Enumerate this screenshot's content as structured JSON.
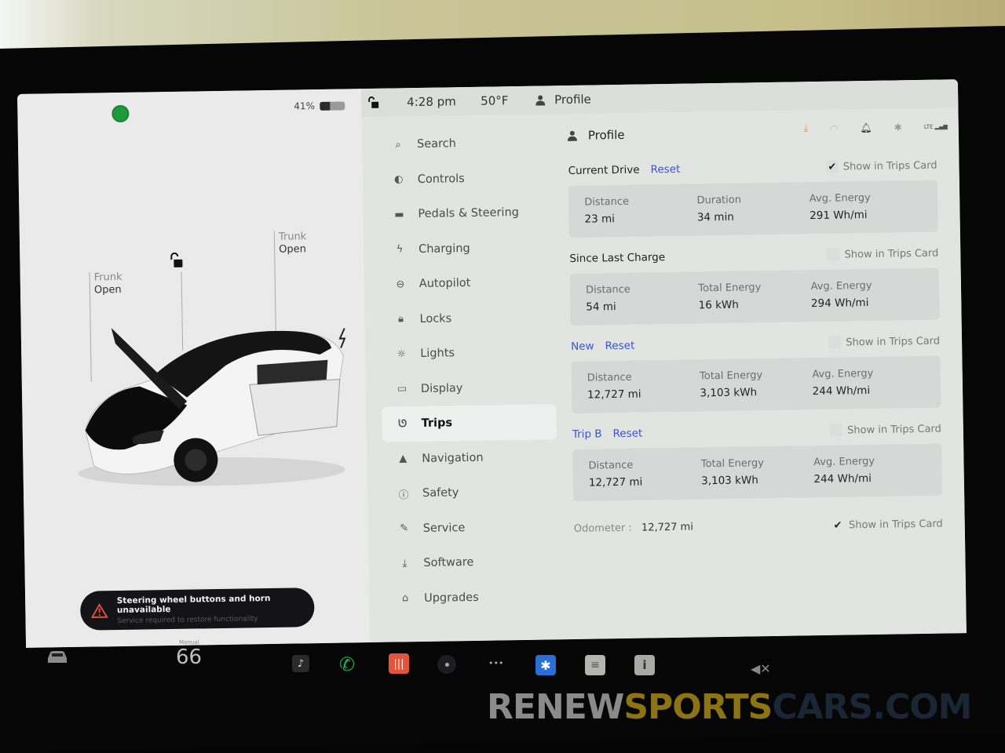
{
  "vehicle_pane": {
    "battery_percent_label": "41%",
    "battery_level": 0.41,
    "frunk": {
      "label": "Frunk",
      "status": "Open"
    },
    "trunk": {
      "label": "Trunk",
      "status": "Open"
    },
    "alert": {
      "title": "Steering wheel buttons and horn unavailable",
      "subtitle": "Service required to restore functionality"
    }
  },
  "topbar": {
    "time": "4:28 pm",
    "temperature": "50°F",
    "profile_label": "Profile"
  },
  "menu": {
    "items": [
      {
        "label": "Search",
        "icon": "search-icon"
      },
      {
        "label": "Controls",
        "icon": "toggle-icon"
      },
      {
        "label": "Pedals & Steering",
        "icon": "car-icon"
      },
      {
        "label": "Charging",
        "icon": "lightning-icon"
      },
      {
        "label": "Autopilot",
        "icon": "steering-wheel-icon"
      },
      {
        "label": "Locks",
        "icon": "lock-icon"
      },
      {
        "label": "Lights",
        "icon": "light-bulb-icon"
      },
      {
        "label": "Display",
        "icon": "display-icon"
      },
      {
        "label": "Trips",
        "icon": "trips-icon",
        "active": true
      },
      {
        "label": "Navigation",
        "icon": "navigation-arrow-icon"
      },
      {
        "label": "Safety",
        "icon": "safety-icon"
      },
      {
        "label": "Service",
        "icon": "wrench-icon"
      },
      {
        "label": "Software",
        "icon": "download-icon"
      },
      {
        "label": "Upgrades",
        "icon": "shopping-bag-icon"
      }
    ]
  },
  "content": {
    "header": "Profile",
    "status_icons": [
      "download-icon",
      "wifi-icon",
      "bell-icon",
      "bluetooth-icon",
      "lte-signal-icon"
    ],
    "lte_label": "LTE",
    "show_in_trips_card_label": "Show in Trips Card",
    "reset_label": "Reset",
    "sections": [
      {
        "title": "Current Drive",
        "has_reset": true,
        "show_in_trips_card": true,
        "stats": [
          {
            "label": "Distance",
            "value": "23 mi"
          },
          {
            "label": "Duration",
            "value": "34 min"
          },
          {
            "label": "Avg. Energy",
            "value": "291 Wh/mi"
          }
        ]
      },
      {
        "title": "Since Last Charge",
        "has_reset": false,
        "show_in_trips_card": false,
        "stats": [
          {
            "label": "Distance",
            "value": "54 mi"
          },
          {
            "label": "Total Energy",
            "value": "16 kWh"
          },
          {
            "label": "Avg. Energy",
            "value": "294 Wh/mi"
          }
        ]
      },
      {
        "title": "New",
        "has_reset": true,
        "title_is_link": true,
        "show_in_trips_card": false,
        "stats": [
          {
            "label": "Distance",
            "value": "12,727 mi"
          },
          {
            "label": "Total Energy",
            "value": "3,103 kWh"
          },
          {
            "label": "Avg. Energy",
            "value": "244 Wh/mi"
          }
        ]
      },
      {
        "title": "Trip B",
        "has_reset": true,
        "title_is_link": true,
        "show_in_trips_card": false,
        "stats": [
          {
            "label": "Distance",
            "value": "12,727 mi"
          },
          {
            "label": "Total Energy",
            "value": "3,103 kWh"
          },
          {
            "label": "Avg. Energy",
            "value": "244 Wh/mi"
          }
        ]
      }
    ],
    "odometer": {
      "label": "Odometer :",
      "value": "12,727 mi",
      "show_in_trips_card": true
    }
  },
  "taskbar": {
    "speed_mode": "Manual",
    "speed": "66",
    "apps": [
      "music-icon",
      "phone-icon",
      "audio-app-icon",
      "camera-icon",
      "more-icon",
      "bluetooth-icon",
      "notepad-icon",
      "info-icon"
    ],
    "more_label": "•••",
    "volume_state": "muted"
  },
  "watermark": {
    "part1": "RENEW",
    "part2": "SPORTS",
    "part3": "CARS.COM"
  },
  "colors": {
    "link": "#3a55c8",
    "status_green": "#1f9a3a",
    "phone_green": "#22b14c",
    "audio_app_orange": "#e2553a",
    "bluetooth_blue": "#2a6fd8"
  }
}
